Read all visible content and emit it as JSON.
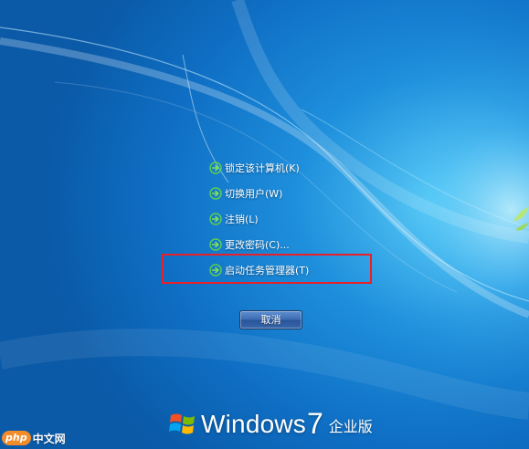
{
  "menu": {
    "items": [
      {
        "label": "锁定该计算机(K)"
      },
      {
        "label": "切换用户(W)"
      },
      {
        "label": "注销(L)"
      },
      {
        "label": "更改密码(C)..."
      },
      {
        "label": "启动任务管理器(T)"
      }
    ]
  },
  "cancel_button": {
    "label": "取消"
  },
  "brand": {
    "name": "Windows",
    "version": "7",
    "edition": "企业版"
  },
  "watermark": {
    "badge": "php",
    "text": "中文网"
  },
  "colors": {
    "highlight_border": "#e8202a",
    "arrow_green": "#5fd04a",
    "background": "#1e8fdc"
  }
}
